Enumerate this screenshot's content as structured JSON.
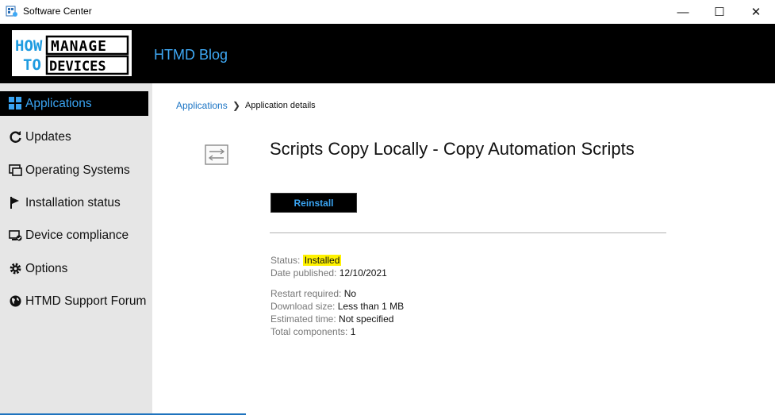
{
  "window": {
    "title": "Software Center",
    "controls": {
      "minimize": "—",
      "maximize": "☐",
      "close": "✕"
    }
  },
  "header": {
    "logo": {
      "how": "HOW",
      "to": "TO",
      "manage": "MANAGE",
      "devices": "DEVICES"
    },
    "brand": "HTMD Blog"
  },
  "sidebar": {
    "items": [
      {
        "label": "Applications",
        "icon": "grid-icon",
        "active": true
      },
      {
        "label": "Updates",
        "icon": "refresh-icon"
      },
      {
        "label": "Operating Systems",
        "icon": "windows-os-icon"
      },
      {
        "label": "Installation status",
        "icon": "flag-icon"
      },
      {
        "label": "Device compliance",
        "icon": "compliance-icon"
      },
      {
        "label": "Options",
        "icon": "gear-icon"
      },
      {
        "label": "HTMD Support Forum",
        "icon": "globe-icon"
      }
    ]
  },
  "breadcrumb": {
    "parent": "Applications",
    "separator": "❯",
    "current": "Application details"
  },
  "app": {
    "title": "Scripts Copy Locally - Copy Automation Scripts",
    "action_label": "Reinstall"
  },
  "details": {
    "status_label": "Status:",
    "status_value": "Installed",
    "date_label": "Date published:",
    "date_value": "12/10/2021",
    "restart_label": "Restart required:",
    "restart_value": "No",
    "download_label": "Download size:",
    "download_value": "Less than 1 MB",
    "time_label": "Estimated time:",
    "time_value": "Not specified",
    "components_label": "Total components:",
    "components_value": "1"
  },
  "colors": {
    "accent": "#3aa4f2",
    "highlight": "#fff200",
    "header_bg": "#000000",
    "sidebar_bg": "#e6e6e6"
  }
}
